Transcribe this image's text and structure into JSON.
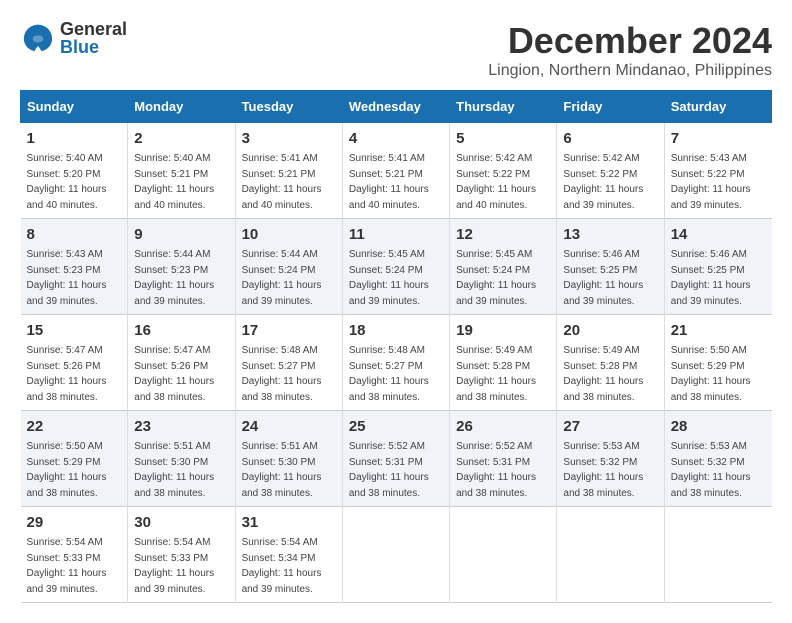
{
  "header": {
    "logo_general": "General",
    "logo_blue": "Blue",
    "month_title": "December 2024",
    "location": "Lingion, Northern Mindanao, Philippines"
  },
  "days_of_week": [
    "Sunday",
    "Monday",
    "Tuesday",
    "Wednesday",
    "Thursday",
    "Friday",
    "Saturday"
  ],
  "weeks": [
    [
      {
        "day": "1",
        "info": "Sunrise: 5:40 AM\nSunset: 5:20 PM\nDaylight: 11 hours\nand 40 minutes."
      },
      {
        "day": "2",
        "info": "Sunrise: 5:40 AM\nSunset: 5:21 PM\nDaylight: 11 hours\nand 40 minutes."
      },
      {
        "day": "3",
        "info": "Sunrise: 5:41 AM\nSunset: 5:21 PM\nDaylight: 11 hours\nand 40 minutes."
      },
      {
        "day": "4",
        "info": "Sunrise: 5:41 AM\nSunset: 5:21 PM\nDaylight: 11 hours\nand 40 minutes."
      },
      {
        "day": "5",
        "info": "Sunrise: 5:42 AM\nSunset: 5:22 PM\nDaylight: 11 hours\nand 40 minutes."
      },
      {
        "day": "6",
        "info": "Sunrise: 5:42 AM\nSunset: 5:22 PM\nDaylight: 11 hours\nand 39 minutes."
      },
      {
        "day": "7",
        "info": "Sunrise: 5:43 AM\nSunset: 5:22 PM\nDaylight: 11 hours\nand 39 minutes."
      }
    ],
    [
      {
        "day": "8",
        "info": "Sunrise: 5:43 AM\nSunset: 5:23 PM\nDaylight: 11 hours\nand 39 minutes."
      },
      {
        "day": "9",
        "info": "Sunrise: 5:44 AM\nSunset: 5:23 PM\nDaylight: 11 hours\nand 39 minutes."
      },
      {
        "day": "10",
        "info": "Sunrise: 5:44 AM\nSunset: 5:24 PM\nDaylight: 11 hours\nand 39 minutes."
      },
      {
        "day": "11",
        "info": "Sunrise: 5:45 AM\nSunset: 5:24 PM\nDaylight: 11 hours\nand 39 minutes."
      },
      {
        "day": "12",
        "info": "Sunrise: 5:45 AM\nSunset: 5:24 PM\nDaylight: 11 hours\nand 39 minutes."
      },
      {
        "day": "13",
        "info": "Sunrise: 5:46 AM\nSunset: 5:25 PM\nDaylight: 11 hours\nand 39 minutes."
      },
      {
        "day": "14",
        "info": "Sunrise: 5:46 AM\nSunset: 5:25 PM\nDaylight: 11 hours\nand 39 minutes."
      }
    ],
    [
      {
        "day": "15",
        "info": "Sunrise: 5:47 AM\nSunset: 5:26 PM\nDaylight: 11 hours\nand 38 minutes."
      },
      {
        "day": "16",
        "info": "Sunrise: 5:47 AM\nSunset: 5:26 PM\nDaylight: 11 hours\nand 38 minutes."
      },
      {
        "day": "17",
        "info": "Sunrise: 5:48 AM\nSunset: 5:27 PM\nDaylight: 11 hours\nand 38 minutes."
      },
      {
        "day": "18",
        "info": "Sunrise: 5:48 AM\nSunset: 5:27 PM\nDaylight: 11 hours\nand 38 minutes."
      },
      {
        "day": "19",
        "info": "Sunrise: 5:49 AM\nSunset: 5:28 PM\nDaylight: 11 hours\nand 38 minutes."
      },
      {
        "day": "20",
        "info": "Sunrise: 5:49 AM\nSunset: 5:28 PM\nDaylight: 11 hours\nand 38 minutes."
      },
      {
        "day": "21",
        "info": "Sunrise: 5:50 AM\nSunset: 5:29 PM\nDaylight: 11 hours\nand 38 minutes."
      }
    ],
    [
      {
        "day": "22",
        "info": "Sunrise: 5:50 AM\nSunset: 5:29 PM\nDaylight: 11 hours\nand 38 minutes."
      },
      {
        "day": "23",
        "info": "Sunrise: 5:51 AM\nSunset: 5:30 PM\nDaylight: 11 hours\nand 38 minutes."
      },
      {
        "day": "24",
        "info": "Sunrise: 5:51 AM\nSunset: 5:30 PM\nDaylight: 11 hours\nand 38 minutes."
      },
      {
        "day": "25",
        "info": "Sunrise: 5:52 AM\nSunset: 5:31 PM\nDaylight: 11 hours\nand 38 minutes."
      },
      {
        "day": "26",
        "info": "Sunrise: 5:52 AM\nSunset: 5:31 PM\nDaylight: 11 hours\nand 38 minutes."
      },
      {
        "day": "27",
        "info": "Sunrise: 5:53 AM\nSunset: 5:32 PM\nDaylight: 11 hours\nand 38 minutes."
      },
      {
        "day": "28",
        "info": "Sunrise: 5:53 AM\nSunset: 5:32 PM\nDaylight: 11 hours\nand 38 minutes."
      }
    ],
    [
      {
        "day": "29",
        "info": "Sunrise: 5:54 AM\nSunset: 5:33 PM\nDaylight: 11 hours\nand 39 minutes."
      },
      {
        "day": "30",
        "info": "Sunrise: 5:54 AM\nSunset: 5:33 PM\nDaylight: 11 hours\nand 39 minutes."
      },
      {
        "day": "31",
        "info": "Sunrise: 5:54 AM\nSunset: 5:34 PM\nDaylight: 11 hours\nand 39 minutes."
      },
      {
        "day": "",
        "info": ""
      },
      {
        "day": "",
        "info": ""
      },
      {
        "day": "",
        "info": ""
      },
      {
        "day": "",
        "info": ""
      }
    ]
  ]
}
